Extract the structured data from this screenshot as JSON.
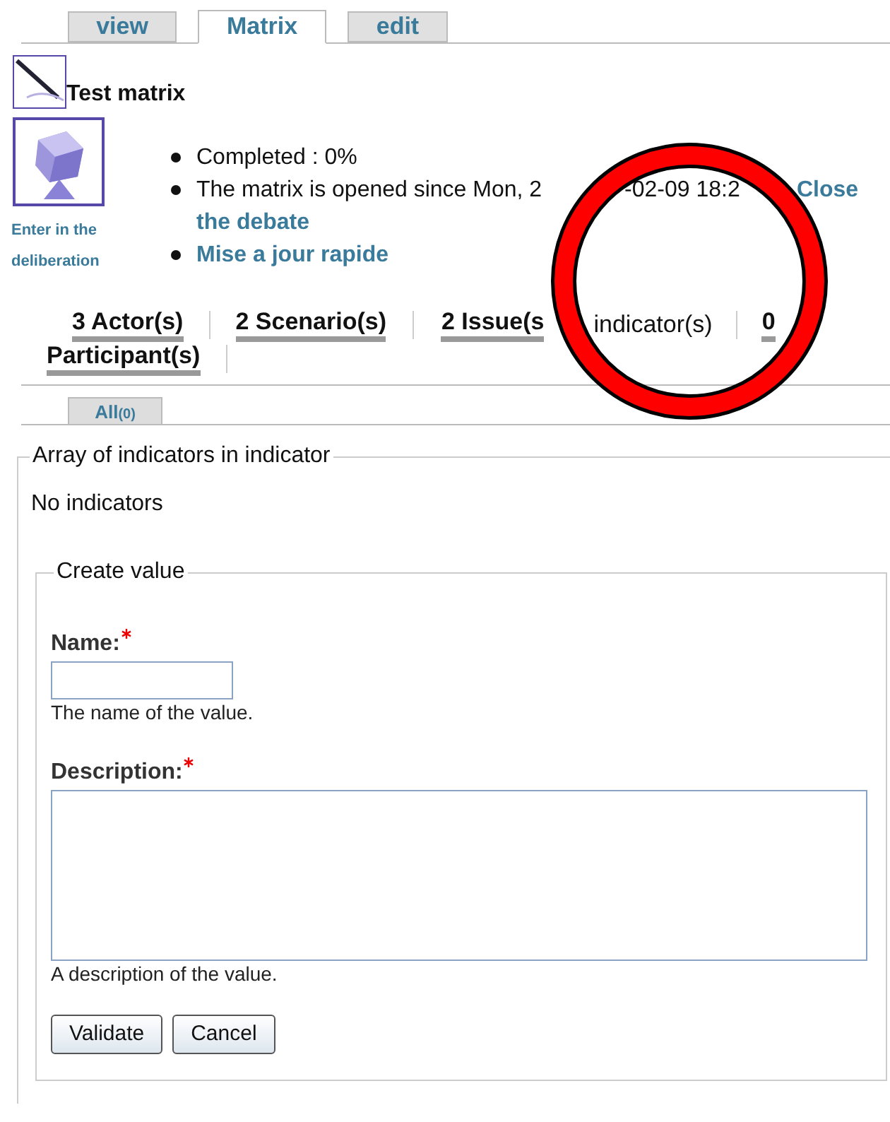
{
  "tabs": [
    {
      "label": "view",
      "selected": false
    },
    {
      "label": "Matrix",
      "selected": true
    },
    {
      "label": "edit",
      "selected": false
    }
  ],
  "matrix": {
    "title": "Test matrix",
    "enter_link": "Enter in the deliberation",
    "info": [
      {
        "kind": "text",
        "text": "Completed : 0%"
      },
      {
        "kind": "opened",
        "parts": [
          "The matrix is opened since Mon, 2",
          "-02-09 18:2"
        ],
        "link_parts": [
          "Close",
          "the debate"
        ]
      },
      {
        "kind": "link",
        "text": "Mise a jour rapide"
      }
    ]
  },
  "counts": [
    {
      "parts": [
        "3 Actor(s)"
      ],
      "selected": false
    },
    {
      "parts": [
        "2 Scenario(s)"
      ],
      "selected": false
    },
    {
      "parts": [
        "2 Issue(s"
      ],
      "selected": false
    },
    {
      "parts": [
        "indicator(s)"
      ],
      "selected": true
    },
    {
      "parts": [
        "0",
        "Participant(s)"
      ],
      "selected": false
    }
  ],
  "subtabs": [
    {
      "label": "All",
      "count": "(0)",
      "selected": true
    }
  ],
  "indicators": {
    "legend": "Array of indicators in indicator",
    "empty": "No indicators"
  },
  "form": {
    "legend": "Create value",
    "fields": [
      {
        "kind": "text",
        "label": "Name:",
        "required": true,
        "help": "The name of the value."
      },
      {
        "kind": "textarea",
        "label": "Description:",
        "required": true,
        "help": "A description of the value."
      }
    ],
    "buttons": [
      "Validate",
      "Cancel"
    ]
  }
}
